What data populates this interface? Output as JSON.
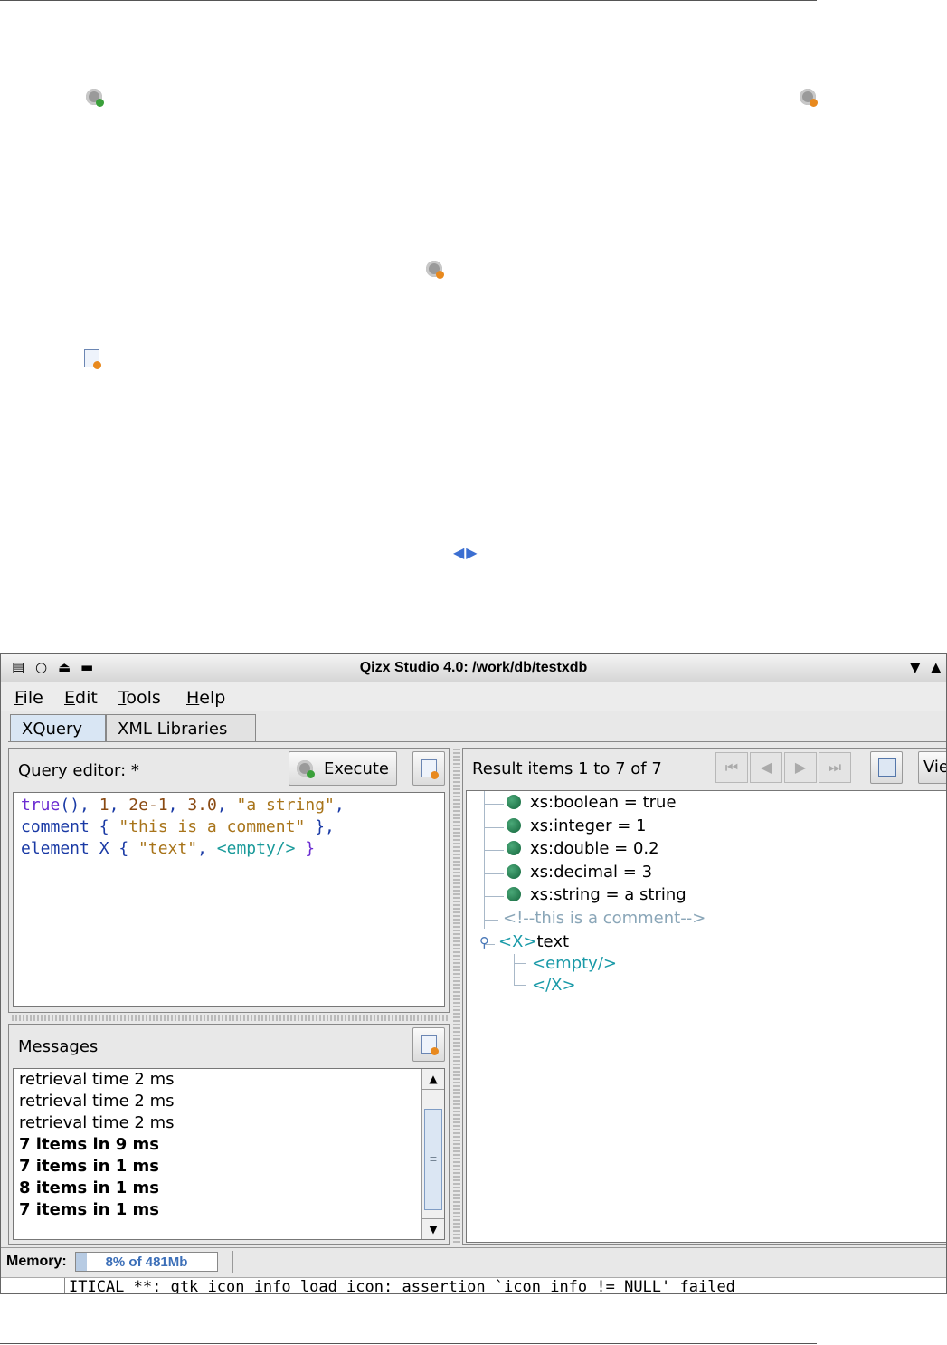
{
  "window": {
    "title": "Qizx Studio 4.0: /work/db/testxdb",
    "controls": [
      "▤",
      "○",
      "⏏",
      "▬"
    ],
    "right_controls": [
      "▼",
      "▲"
    ]
  },
  "menu": {
    "items": [
      {
        "label": "File"
      },
      {
        "label": "Edit"
      },
      {
        "label": "Tools"
      },
      {
        "label": "Help"
      }
    ]
  },
  "tabs": [
    {
      "label": "XQuery",
      "active": true
    },
    {
      "label": "XML Libraries",
      "active": false
    }
  ],
  "editor": {
    "header": "Query editor:  *",
    "execute_label": "Execute",
    "lines": [
      [
        [
          "kw",
          "true"
        ],
        [
          "fn",
          "()"
        ],
        [
          "pl",
          ", "
        ],
        [
          "num",
          "1"
        ],
        [
          "pl",
          ", "
        ],
        [
          "num",
          "2e-1"
        ],
        [
          "pl",
          ", "
        ],
        [
          "num",
          "3.0"
        ],
        [
          "pl",
          ", "
        ],
        [
          "str",
          "\"a string\""
        ],
        [
          "pl",
          ","
        ]
      ],
      [
        [
          "fn",
          "comment"
        ],
        [
          "pl",
          " { "
        ],
        [
          "str",
          "\"this is a comment\""
        ],
        [
          "pl",
          " },"
        ]
      ],
      [
        [
          "fn",
          "element"
        ],
        [
          "pl",
          " X { "
        ],
        [
          "str",
          "\"text\""
        ],
        [
          "pl",
          ", "
        ],
        [
          "xml",
          "<empty/>"
        ],
        [
          "kw",
          " }"
        ]
      ]
    ]
  },
  "messages": {
    "header": "Messages",
    "lines": [
      {
        "text": "retrieval time 2 ms",
        "bold": false
      },
      {
        "text": "retrieval time 2 ms",
        "bold": false
      },
      {
        "text": "retrieval time 2 ms",
        "bold": false
      },
      {
        "text": "7 items in 9 ms",
        "bold": true
      },
      {
        "text": "7 items in 1 ms",
        "bold": true
      },
      {
        "text": "8 items in 1 ms",
        "bold": true
      },
      {
        "text": "7 items in 1 ms",
        "bold": true
      }
    ]
  },
  "results": {
    "header": "Result items 1 to 7 of 7",
    "view_label": "Vie",
    "nav": [
      "⏮",
      "◀",
      "▶",
      "⏭"
    ],
    "items": [
      {
        "text": "xs:boolean = true",
        "kind": "atomic"
      },
      {
        "text": "xs:integer = 1",
        "kind": "atomic"
      },
      {
        "text": "xs:double = 0.2",
        "kind": "atomic"
      },
      {
        "text": "xs:decimal = 3",
        "kind": "atomic"
      },
      {
        "text": "xs:string = a string",
        "kind": "atomic"
      },
      {
        "text": "<!--this is a comment-->",
        "kind": "comment"
      }
    ],
    "element": {
      "open": "<X>",
      "text": "text",
      "child": "<empty/>",
      "close": "</X>"
    }
  },
  "status": {
    "memory_label": "Memory:",
    "memory_text": "8% of 481Mb",
    "memory_fraction": 0.08
  },
  "console": {
    "text": "ITICAL **: gtk_icon_info_load_icon: assertion `icon_info != NULL' failed"
  }
}
